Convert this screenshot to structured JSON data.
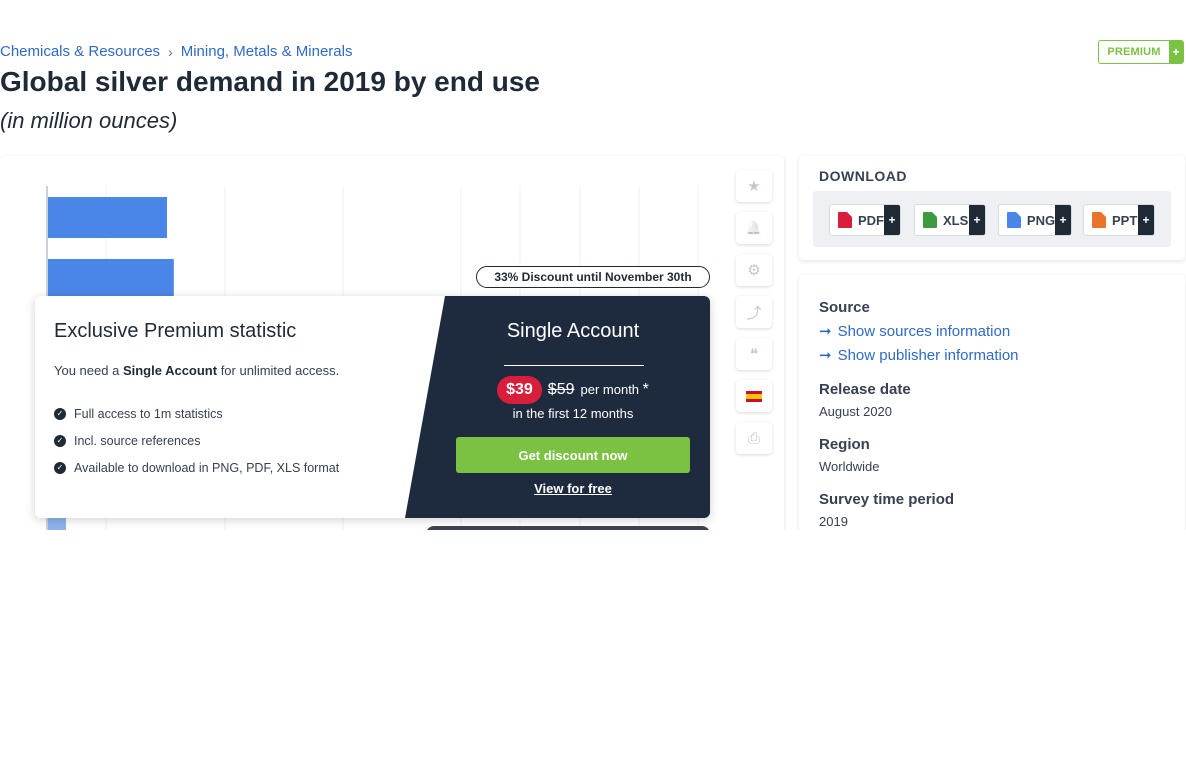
{
  "breadcrumb": {
    "items": [
      "Chemicals & Resources",
      "Mining, Metals & Minerals"
    ],
    "separator": "›"
  },
  "premium_badge": {
    "label": "PREMIUM",
    "plus": "+"
  },
  "page": {
    "title": "Global silver demand in 2019 by end use",
    "subtitle": "(in million ounces)"
  },
  "chart": {
    "bar_color": "#4a86e8",
    "visible_bar_values": [
      0.35,
      0.37
    ],
    "axis_max": 1
  },
  "discount_pill": "33% Discount until November 30th",
  "paywall": {
    "title": "Exclusive Premium statistic",
    "need_prefix": "You need a ",
    "need_account": "Single Account",
    "need_suffix": " for unlimited access.",
    "features": [
      "Full access to 1m statistics",
      "Incl. source references",
      "Available to download in PNG, PDF, XLS format"
    ],
    "account_title": "Single Account",
    "price_new": "$39",
    "price_old": "$59",
    "per_month": "per month",
    "asterisk": "*",
    "first_months": "in the first 12 months",
    "cta": "Get discount now",
    "view_free": "View for free"
  },
  "toolbar": {
    "icons": [
      "star-icon",
      "bell-icon",
      "gear-icon",
      "share-icon",
      "quote-icon",
      "spain-flag-icon",
      "print-icon"
    ],
    "glyphs": [
      "★",
      "🔔",
      "⚙",
      "⤴",
      "❝",
      "",
      "⎙"
    ]
  },
  "download": {
    "heading": "DOWNLOAD",
    "buttons": [
      {
        "label": "PDF",
        "color": "#d81e3a"
      },
      {
        "label": "XLS",
        "color": "#3c9a3f"
      },
      {
        "label": "PNG",
        "color": "#4a86e8"
      },
      {
        "label": "PPT",
        "color": "#e8742a"
      }
    ],
    "plus": "+"
  },
  "details": {
    "source_heading": "Source",
    "show_sources": "Show sources information",
    "show_publisher": "Show publisher information",
    "release_heading": "Release date",
    "release_value": "August 2020",
    "region_heading": "Region",
    "region_value": "Worldwide",
    "survey_heading": "Survey time period",
    "survey_value": "2019"
  },
  "colors": {
    "link": "#2f6ac6",
    "accent_green": "#7cc242",
    "dark_panel": "#1e2b3e",
    "discount_red": "#d81e3a"
  }
}
